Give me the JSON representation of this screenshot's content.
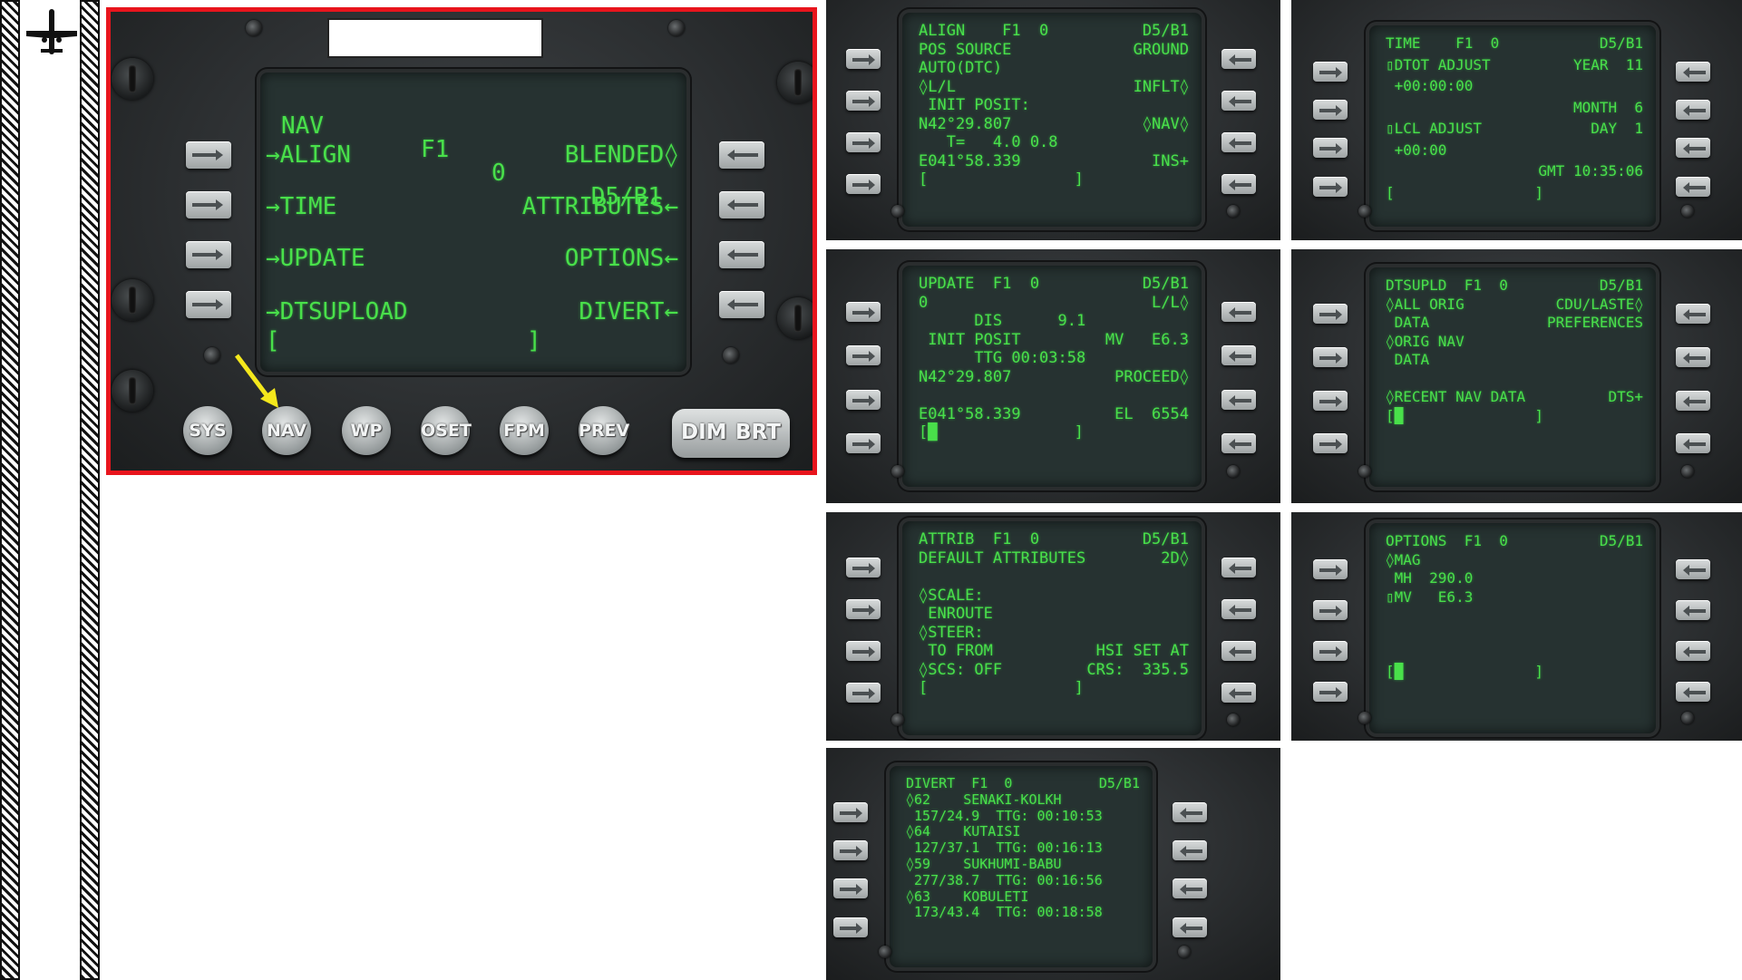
{
  "main": {
    "header": {
      "page": "NAV",
      "flight": "F1",
      "num": "0",
      "ver": "D5/B1"
    },
    "left_items": [
      "ALIGN",
      "TIME",
      "UPDATE",
      "DTSUPLOAD"
    ],
    "right_items": [
      "BLENDED",
      "ATTRIBUTES",
      "OPTIONS",
      "DIVERT"
    ],
    "bracket_left": "[",
    "bracket_right": "]",
    "function_keys": [
      "SYS",
      "NAV",
      "WP",
      "OSET",
      "FPM",
      "PREV"
    ],
    "dim_label": "DIM",
    "brt_label": "BRT",
    "highlight_color": "#e8151d",
    "arrow_color": "#f4e81c"
  },
  "screens": {
    "align": [
      {
        "l": "ALIGN    F1  0",
        "r": "D5/B1"
      },
      {
        "l": "POS SOURCE",
        "r": "GROUND"
      },
      {
        "l": "AUTO(DTC)"
      },
      {
        "l": "◊L/L",
        "r": "INFLT◊"
      },
      {
        "l": " INIT POSIT:"
      },
      {
        "l": "N42°29.807",
        "r": "◊NAV◊"
      },
      {
        "l": "   T=   4.0 0.8"
      },
      {
        "l": "E041°58.339",
        "r": "INS+"
      },
      {
        "l": "[",
        "c": "]"
      }
    ],
    "time": [
      {
        "l": "TIME    F1  0",
        "r": "D5/B1"
      },
      {
        "l": "▯DTOT ADJUST",
        "r": "YEAR  11"
      },
      {
        "l": " +00:00:00"
      },
      {
        "l": "",
        "r": "MONTH  6"
      },
      {
        "l": "▯LCL ADJUST",
        "r": "DAY  1"
      },
      {
        "l": " +00:00"
      },
      {
        "l": "",
        "r": "GMT 10:35:06"
      },
      {
        "l": "[",
        "c": "]"
      }
    ],
    "update": [
      {
        "l": "UPDATE  F1  0",
        "r": "D5/B1"
      },
      {
        "l": "0",
        "r": "L/L◊"
      },
      {
        "l": "      DIS      9.1"
      },
      {
        "l": " INIT POSIT",
        "r": "MV   E6.3"
      },
      {
        "l": "      TTG 00:03:58"
      },
      {
        "l": "N42°29.807",
        "r": "PROCEED◊"
      },
      {
        "l": ""
      },
      {
        "l": "E041°58.339",
        "r": "EL  6554"
      },
      {
        "l": "[█",
        "c": "]"
      }
    ],
    "dtsupld": [
      {
        "l": "DTSUPLD  F1  0",
        "r": "D5/B1"
      },
      {
        "l": "◊ALL ORIG",
        "r": "CDU/LASTE◊"
      },
      {
        "l": " DATA",
        "r": "PREFERENCES"
      },
      {
        "l": "◊ORIG NAV"
      },
      {
        "l": " DATA"
      },
      {
        "l": ""
      },
      {
        "l": "◊RECENT NAV DATA",
        "r": "DTS+"
      },
      {
        "l": "[█",
        "c": "]"
      }
    ],
    "attrib": [
      {
        "l": "ATTRIB  F1  0",
        "r": "D5/B1"
      },
      {
        "l": "DEFAULT ATTRIBUTES",
        "r": "2D◊"
      },
      {
        "l": ""
      },
      {
        "l": "◊SCALE:"
      },
      {
        "l": " ENROUTE"
      },
      {
        "l": "◊STEER:"
      },
      {
        "l": " TO FROM",
        "r": "HSI SET AT"
      },
      {
        "l": "◊SCS: OFF",
        "r": "CRS:  335.5"
      },
      {
        "l": "[",
        "c": "]"
      }
    ],
    "options": [
      {
        "l": "OPTIONS  F1  0",
        "r": "D5/B1"
      },
      {
        "l": "◊MAG"
      },
      {
        "l": " MH  290.0"
      },
      {
        "l": "▯MV   E6.3"
      },
      {
        "l": ""
      },
      {
        "l": ""
      },
      {
        "l": ""
      },
      {
        "l": "[█",
        "c": "]"
      }
    ],
    "divert": [
      {
        "l": "DIVERT  F1  0",
        "r": "D5/B1"
      },
      {
        "l": "◊62    SENAKI-KOLKH"
      },
      {
        "l": " 157/24.9  TTG: 00:10:53"
      },
      {
        "l": "◊64    KUTAISI"
      },
      {
        "l": " 127/37.1  TTG: 00:16:13"
      },
      {
        "l": "◊59    SUKHUMI-BABU"
      },
      {
        "l": " 277/38.7  TTG: 00:16:56"
      },
      {
        "l": "◊63    KOBULETI"
      },
      {
        "l": " 173/43.4  TTG: 00:18:58"
      }
    ]
  }
}
